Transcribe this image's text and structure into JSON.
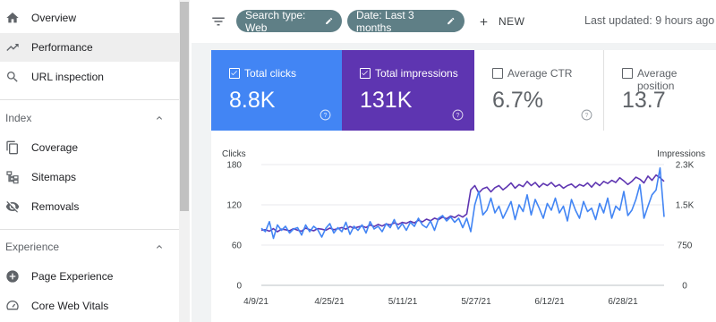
{
  "sidebar": {
    "items": [
      {
        "label": "Overview"
      },
      {
        "label": "Performance"
      },
      {
        "label": "URL inspection"
      },
      {
        "label": "Coverage"
      },
      {
        "label": "Sitemaps"
      },
      {
        "label": "Removals"
      },
      {
        "label": "Page Experience"
      },
      {
        "label": "Core Web Vitals"
      }
    ],
    "sections": [
      {
        "label": "Index"
      },
      {
        "label": "Experience"
      }
    ]
  },
  "filters": {
    "search_type": "Search type: Web",
    "date": "Date: Last 3 months",
    "new_label": "NEW",
    "last_updated": "Last updated: 9 hours ago"
  },
  "metrics": [
    {
      "label": "Total clicks",
      "value": "8.8K",
      "checked": true,
      "color": "#4285f4"
    },
    {
      "label": "Total impressions",
      "value": "131K",
      "checked": true,
      "color": "#5e35b1"
    },
    {
      "label": "Average CTR",
      "value": "6.7%",
      "checked": false
    },
    {
      "label": "Average position",
      "value": "13.7",
      "checked": false
    }
  ],
  "chart_data": {
    "type": "line",
    "ylabel_left": "Clicks",
    "ylabel_right": "Impressions",
    "yticks_left": [
      "180",
      "120",
      "60",
      "0"
    ],
    "yticks_right": [
      "2.3K",
      "1.5K",
      "750",
      "0"
    ],
    "ylim_left": [
      0,
      180
    ],
    "ylim_right": [
      0,
      2300
    ],
    "x_labels": [
      "4/9/21",
      "4/25/21",
      "5/11/21",
      "5/27/21",
      "6/12/21",
      "6/28/21"
    ],
    "grid": true,
    "series": [
      {
        "name": "Clicks",
        "axis": "left",
        "color": "#4285f4",
        "values": [
          85,
          80,
          95,
          70,
          90,
          82,
          88,
          78,
          84,
          86,
          75,
          90,
          80,
          88,
          83,
          72,
          85,
          92,
          78,
          86,
          80,
          94,
          76,
          88,
          82,
          90,
          78,
          95,
          84,
          88,
          80,
          92,
          86,
          98,
          84,
          92,
          82,
          94,
          88,
          100,
          90,
          86,
          96,
          82,
          100,
          104,
          96,
          102,
          94,
          100,
          86,
          100,
          80,
          120,
          140,
          105,
          112,
          130,
          108,
          118,
          100,
          112,
          125,
          98,
          120,
          110,
          135,
          105,
          128,
          115,
          100,
          122,
          112,
          130,
          108,
          118,
          96,
          128,
          112,
          100,
          125,
          110,
          115,
          98,
          122,
          108,
          130,
          100,
          118,
          112,
          140,
          104,
          112,
          128,
          150,
          100,
          118,
          135,
          142,
          175,
          102
        ]
      },
      {
        "name": "Impressions",
        "axis": "right",
        "color": "#5e35b1",
        "values": [
          1050,
          1060,
          1030,
          1080,
          1020,
          1070,
          1060,
          1040,
          1080,
          1050,
          1030,
          1090,
          1060,
          1040,
          1080,
          1070,
          1050,
          1090,
          1060,
          1080,
          1100,
          1070,
          1120,
          1090,
          1110,
          1130,
          1100,
          1150,
          1120,
          1160,
          1130,
          1170,
          1150,
          1190,
          1160,
          1200,
          1180,
          1220,
          1190,
          1240,
          1210,
          1260,
          1230,
          1280,
          1250,
          1300,
          1270,
          1320,
          1290,
          1340,
          1300,
          1360,
          1820,
          1900,
          1760,
          1840,
          1870,
          1780,
          1860,
          1900,
          1820,
          1880,
          1950,
          1850,
          1920,
          1880,
          1980,
          1900,
          1960,
          1870,
          1940,
          1900,
          1960,
          1880,
          1920,
          1850,
          1900,
          1930,
          1860,
          1920,
          1890,
          1950,
          1870,
          1960,
          1900,
          1980,
          1940,
          2000,
          1960,
          2050,
          1990,
          1920,
          1980,
          2060,
          2020,
          1950,
          2080,
          2000,
          2100,
          2050,
          1980
        ]
      }
    ]
  }
}
